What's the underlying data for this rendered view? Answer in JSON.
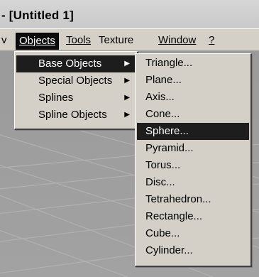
{
  "window": {
    "title": "- [Untitled 1]"
  },
  "menubar": {
    "items": [
      {
        "label": "v"
      },
      {
        "label": "Objects",
        "active": true
      },
      {
        "label": "Tools"
      },
      {
        "label": "Texture"
      },
      {
        "label": "Window"
      },
      {
        "label": "?"
      }
    ]
  },
  "objects_menu": {
    "items": [
      {
        "label": "Base Objects",
        "submenu": true,
        "highlighted": true
      },
      {
        "label": "Special Objects",
        "submenu": true
      },
      {
        "label": "Splines",
        "submenu": true
      },
      {
        "label": "Spline Objects",
        "submenu": true
      }
    ]
  },
  "base_objects_menu": {
    "items": [
      {
        "label": "Triangle..."
      },
      {
        "label": "Plane..."
      },
      {
        "label": "Axis..."
      },
      {
        "label": "Cone..."
      },
      {
        "label": "Sphere...",
        "highlighted": true
      },
      {
        "label": "Pyramid..."
      },
      {
        "label": "Torus..."
      },
      {
        "label": "Disc..."
      },
      {
        "label": "Tetrahedron..."
      },
      {
        "label": "Rectangle..."
      },
      {
        "label": "Cube..."
      },
      {
        "label": "Cylinder..."
      }
    ]
  },
  "colors": {
    "highlight": "#1d1d1d",
    "menu_bg": "#d4d0c8",
    "viewport_bg": "#9e9e9e"
  }
}
